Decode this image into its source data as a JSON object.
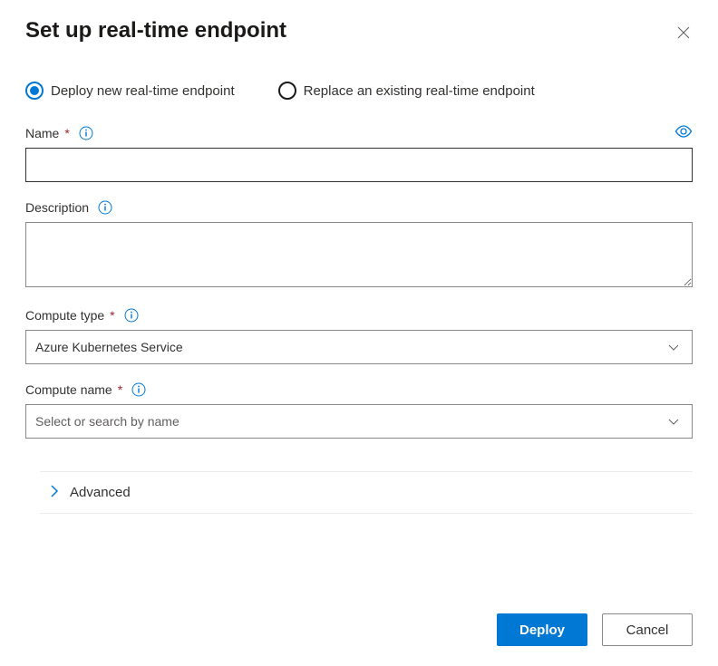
{
  "header": {
    "title": "Set up real-time endpoint"
  },
  "radio": {
    "deploy_new": "Deploy new real-time endpoint",
    "replace_existing": "Replace an existing real-time endpoint"
  },
  "fields": {
    "name": {
      "label": "Name",
      "value": ""
    },
    "description": {
      "label": "Description",
      "value": ""
    },
    "compute_type": {
      "label": "Compute type",
      "value": "Azure Kubernetes Service"
    },
    "compute_name": {
      "label": "Compute name",
      "placeholder": "Select or search by name"
    }
  },
  "advanced": {
    "label": "Advanced"
  },
  "buttons": {
    "deploy": "Deploy",
    "cancel": "Cancel"
  }
}
